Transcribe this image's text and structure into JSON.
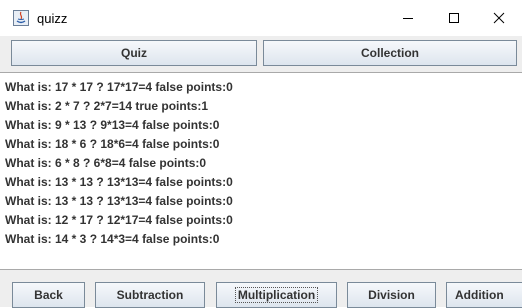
{
  "window": {
    "title": "quizz"
  },
  "tabs": [
    {
      "label": "Quiz"
    },
    {
      "label": "Collection"
    }
  ],
  "results": [
    "What is: 17 * 17 ? 17*17=4 false points:0",
    "What is: 2 * 7 ? 2*7=14 true points:1",
    "What is: 9 * 13 ? 9*13=4 false points:0",
    "What is: 18 * 6 ? 18*6=4 false points:0",
    "What is: 6 * 8 ? 6*8=4 false points:0",
    "What is: 13 * 13 ? 13*13=4 false points:0",
    "What is: 13 * 13 ? 13*13=4 false points:0",
    "What is: 12 * 17 ? 12*17=4 false points:0",
    "What is: 14 * 3 ? 14*3=4 false points:0"
  ],
  "buttons": {
    "back": "Back",
    "subtraction": "Subtraction",
    "multiplication": "Multiplication",
    "division": "Division",
    "addition": "Addition"
  }
}
